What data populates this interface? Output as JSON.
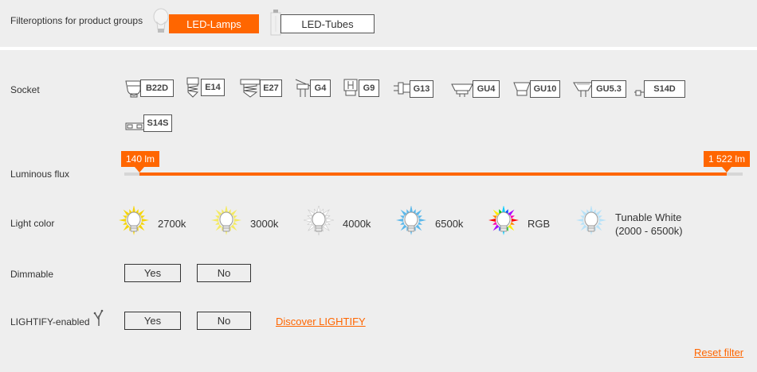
{
  "product_groups": {
    "label": "Filteroptions for product groups",
    "options": [
      {
        "label": "LED-Lamps",
        "active": true
      },
      {
        "label": "LED-Tubes",
        "active": false
      }
    ]
  },
  "socket": {
    "label": "Socket",
    "options": [
      "B22D",
      "E14",
      "E27",
      "G4",
      "G9",
      "G13",
      "GU4",
      "GU10",
      "GU5.3",
      "S14D",
      "S14S"
    ]
  },
  "luminous_flux": {
    "label": "Luminous flux",
    "min_label": "140 lm",
    "max_label": "1 522 lm",
    "min_value": 140,
    "max_value": 1522
  },
  "light_color": {
    "label": "Light color",
    "options": [
      {
        "label": "2700k",
        "color": "#f5d50a",
        "icon": "warm-yellow-bulb-icon"
      },
      {
        "label": "3000k",
        "color": "#f4ea64",
        "icon": "soft-yellow-bulb-icon"
      },
      {
        "label": "4000k",
        "color": "#ffffff",
        "icon": "white-bulb-icon"
      },
      {
        "label": "6500k",
        "color": "#5cb8ea",
        "icon": "blue-bulb-icon"
      },
      {
        "label": "RGB",
        "color": "#ff00aa",
        "icon": "rgb-bulb-icon"
      },
      {
        "label": "Tunable White",
        "label2": "(2000 - 6500k)",
        "color": "#b8e2f8",
        "icon": "tunable-white-bulb-icon"
      }
    ]
  },
  "dimmable": {
    "label": "Dimmable",
    "yes": "Yes",
    "no": "No"
  },
  "lightify": {
    "label": "LIGHTIFY-enabled",
    "yes": "Yes",
    "no": "No",
    "link": "Discover LIGHTIFY"
  },
  "reset": "Reset filter"
}
